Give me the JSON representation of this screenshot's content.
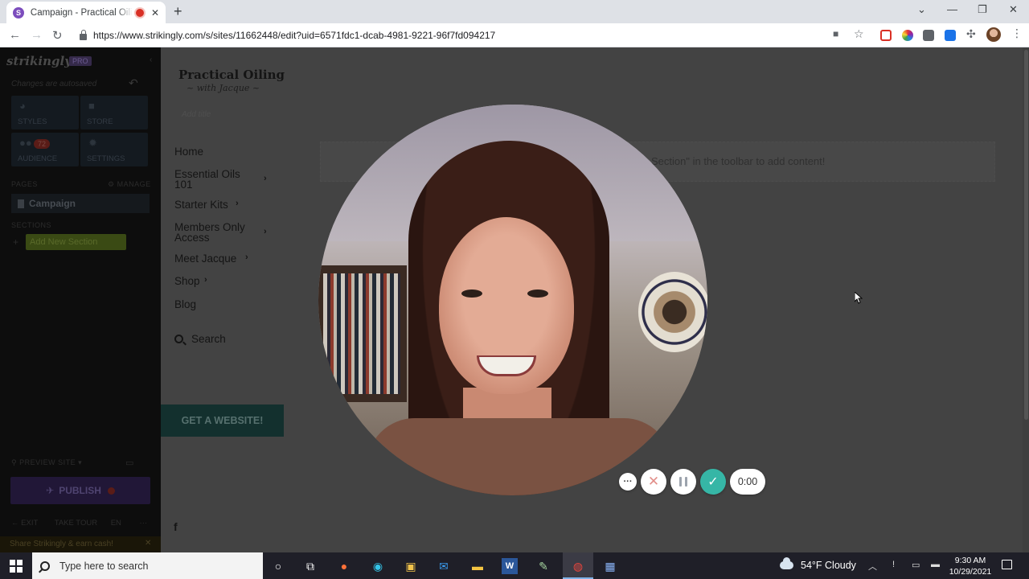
{
  "browser": {
    "tab_title": "Campaign - Practical Oiling w",
    "tab_favicon": "S",
    "new_tab_glyph": "+",
    "url": "https://www.strikingly.com/s/sites/11662448/edit?uid=6571fdc1-dcab-4981-9221-96f7fd094217",
    "window": {
      "minimize": "—",
      "restore": "❐",
      "close": "✕",
      "dropdown": "⌄"
    }
  },
  "editor": {
    "logo": "strikingly",
    "plan_badge": "PRO",
    "saved_text": "Changes are autosaved",
    "tiles": [
      {
        "label": "STYLES",
        "icon": "palette-icon"
      },
      {
        "label": "STORE",
        "icon": "bag-icon"
      },
      {
        "label": "AUDIENCE",
        "icon": "people-icon",
        "badge": "72"
      },
      {
        "label": "SETTINGS",
        "icon": "gear-icon"
      }
    ],
    "pages_label": "PAGES",
    "manage_label": "MANAGE",
    "current_page": "Campaign",
    "sections_label": "SECTIONS",
    "add_section": "Add New Section",
    "preview_label": "PREVIEW SITE ▾",
    "publish_label": "PUBLISH",
    "exit_label": "EXIT",
    "tour_label": "TAKE TOUR",
    "lang_label": "EN",
    "share_text": "Share Strikingly & earn cash!"
  },
  "site": {
    "logo_title": "Practical Oiling",
    "logo_sub": "~ with Jacque ~",
    "add_title": "Add title",
    "nav": [
      {
        "label": "Home",
        "chevron": false
      },
      {
        "label": "Essential Oils 101",
        "chevron": true
      },
      {
        "label": "Starter Kits",
        "chevron": true
      },
      {
        "label": "Members Only Access",
        "chevron": true
      },
      {
        "label": "Meet Jacque",
        "chevron": true
      },
      {
        "label": "Shop",
        "chevron": true
      },
      {
        "label": "Blog",
        "chevron": false
      }
    ],
    "search_label": "Search",
    "cta_label": "GET A WEBSITE!",
    "facebook_glyph": "f",
    "placeholder_text": "Section\" in the toolbar to add content!"
  },
  "recorder": {
    "more_glyph": "···",
    "cancel_glyph": "✕",
    "done_glyph": "✓",
    "timer": "0:00"
  },
  "taskbar": {
    "search_placeholder": "Type here to search",
    "weather": "54°F  Cloudy",
    "time": "9:30 AM",
    "date": "10/29/2021"
  }
}
